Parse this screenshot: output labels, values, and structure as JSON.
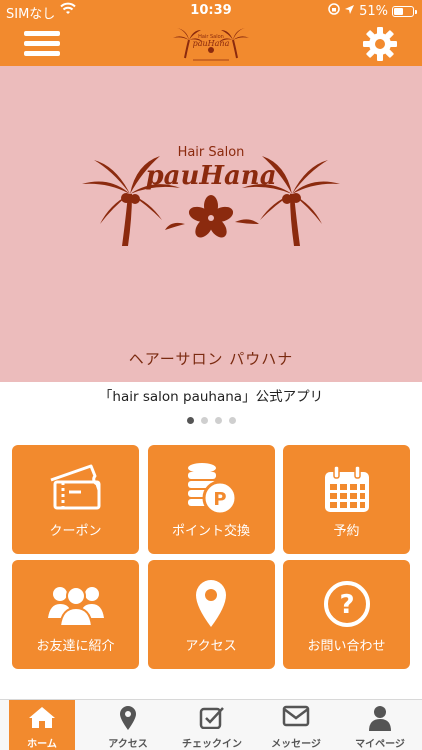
{
  "status_bar": {
    "carrier": "SIMなし",
    "time": "10:39",
    "battery": "51%",
    "battery_level": 0.51
  },
  "header": {
    "logo_text": "Hair Salon pauHana",
    "menu_icon": "hamburger-menu-icon",
    "settings_icon": "gear-icon"
  },
  "hero": {
    "logo_small": "Hair Salon",
    "logo_large": "pauHana",
    "subtitle": "ヘアーサロン パウハナ",
    "caption": "「hair salon pauhana」公式アプリ",
    "slides": 4,
    "active_slide": 1
  },
  "tiles": [
    {
      "label": "クーポン",
      "icon": "ticket-icon"
    },
    {
      "label": "ポイント交換",
      "icon": "coins-icon"
    },
    {
      "label": "予約",
      "icon": "calendar-icon"
    },
    {
      "label": "お友達に紹介",
      "icon": "people-icon"
    },
    {
      "label": "アクセス",
      "icon": "map-pin-icon"
    },
    {
      "label": "お問い合わせ",
      "icon": "question-icon"
    }
  ],
  "tabbar": [
    {
      "label": "ホーム",
      "icon": "home-icon",
      "active": true
    },
    {
      "label": "アクセス",
      "icon": "map-pin-icon",
      "active": false
    },
    {
      "label": "チェックイン",
      "icon": "checkin-icon",
      "active": false
    },
    {
      "label": "メッセージ",
      "icon": "mail-icon",
      "active": false
    },
    {
      "label": "マイページ",
      "icon": "person-icon",
      "active": false
    }
  ],
  "colors": {
    "accent": "#f28a2e",
    "hero_bg": "#ecbcbc",
    "brand_dark": "#8b2a0e"
  }
}
